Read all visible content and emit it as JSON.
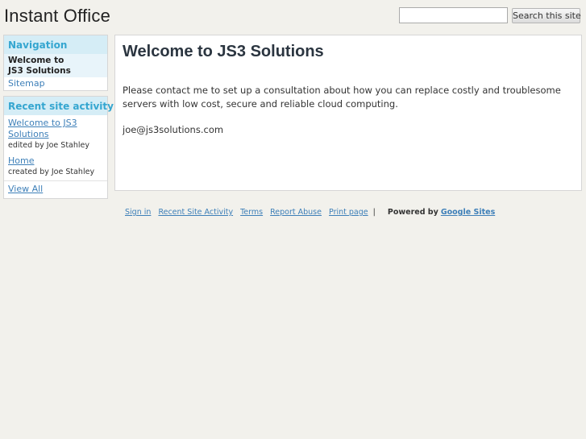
{
  "header": {
    "site_title": "Instant Office",
    "search_value": "",
    "search_button": "Search this site"
  },
  "navigation": {
    "title": "Navigation",
    "items": [
      {
        "label": "Welcome to JS3 Solutions",
        "current": true
      },
      {
        "label": "Sitemap",
        "current": false
      }
    ]
  },
  "recent_activity": {
    "title": "Recent site activity",
    "items": [
      {
        "link": "Welcome to JS3 Solutions",
        "meta": "edited by Joe Stahley"
      },
      {
        "link": "Home",
        "meta": "created by Joe Stahley"
      }
    ],
    "view_all": "View All"
  },
  "main": {
    "title": "Welcome to JS3 Solutions",
    "paragraphs": [
      "Please contact me to set up a consultation about how you can replace costly and troublesome servers with low cost, secure and reliable cloud computing.",
      "joe@js3solutions.com"
    ]
  },
  "footer": {
    "links": [
      "Sign in",
      "Recent Site Activity",
      "Terms",
      "Report Abuse",
      "Print page"
    ],
    "separator": "|",
    "powered_by": "Powered by",
    "google_sites": "Google Sites"
  },
  "colors": {
    "background": "#f2f1ec",
    "sidebar_title_bg": "#d5edf6",
    "sidebar_title_text": "#35a6d0",
    "link": "#3d7fb8"
  }
}
